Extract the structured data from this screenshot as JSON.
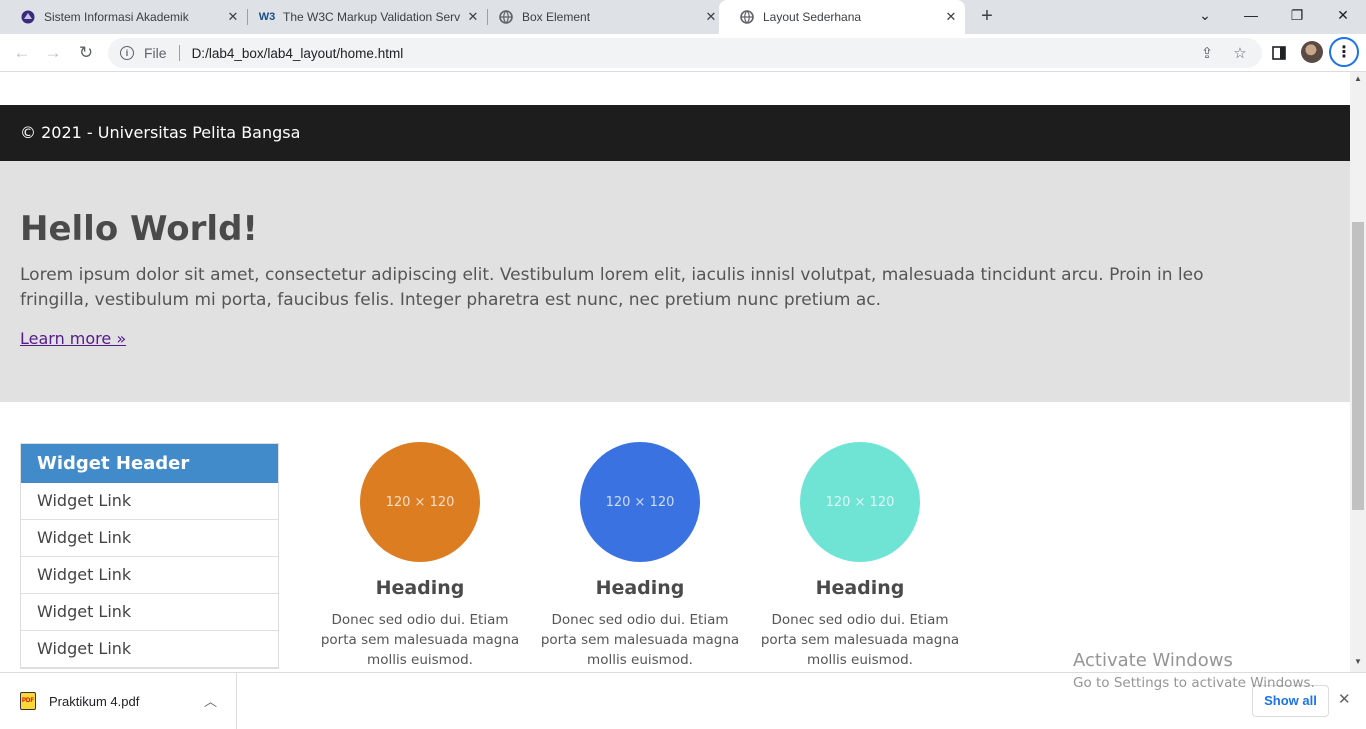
{
  "browser": {
    "tabs": [
      {
        "title": "Sistem Informasi Akademik",
        "favicon": "university-icon",
        "active": false
      },
      {
        "title": "The W3C Markup Validation Serv",
        "favicon": "w3c-icon",
        "active": false
      },
      {
        "title": "Box Element",
        "favicon": "globe-icon",
        "active": false
      },
      {
        "title": "Layout Sederhana",
        "favicon": "globe-icon",
        "active": true
      }
    ],
    "omnibox": {
      "scheme": "File",
      "url": "D:/lab4_box/lab4_layout/home.html"
    }
  },
  "page": {
    "footer_text": "© 2021 - Universitas Pelita Bangsa",
    "hero": {
      "title": "Hello World!",
      "text": "Lorem ipsum dolor sit amet, consectetur adipiscing elit. Vestibulum lorem elit, iaculis innisl volutpat, malesuada tincidunt arcu. Proin in leo fringilla, vestibulum mi porta, faucibus felis. Integer pharetra est nunc, nec pretium nunc pretium ac.",
      "link": "Learn more »"
    },
    "widget": {
      "header": "Widget Header",
      "links": [
        "Widget Link",
        "Widget Link",
        "Widget Link",
        "Widget Link",
        "Widget Link"
      ]
    },
    "features": [
      {
        "image_label": "120 × 120",
        "color": "#dd7d22",
        "heading": "Heading",
        "text": "Donec sed odio dui. Etiam porta sem malesuada magna mollis euismod."
      },
      {
        "image_label": "120 × 120",
        "color": "#3b72e2",
        "heading": "Heading",
        "text": "Donec sed odio dui. Etiam porta sem malesuada magna mollis euismod."
      },
      {
        "image_label": "120 × 120",
        "color": "#6fe4d5",
        "heading": "Heading",
        "text": "Donec sed odio dui. Etiam porta sem malesuada magna mollis euismod."
      }
    ]
  },
  "downloads": {
    "file": "Praktikum 4.pdf",
    "show_all": "Show all"
  },
  "watermark": {
    "line1": "Activate Windows",
    "line2": "Go to Settings to activate Windows."
  }
}
